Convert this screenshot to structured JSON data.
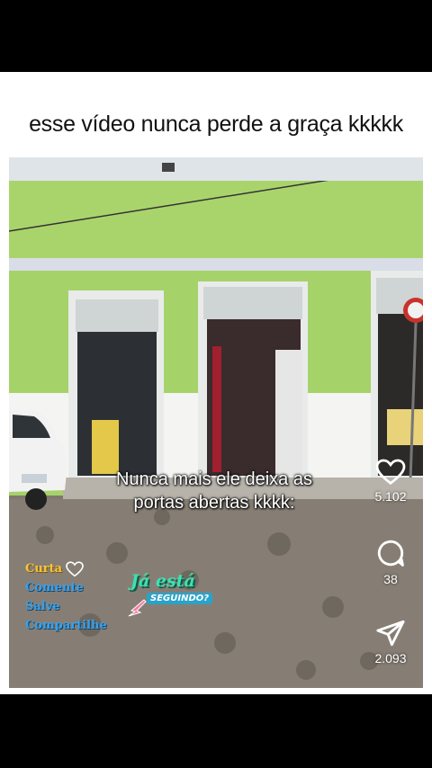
{
  "post": {
    "caption": "esse vídeo nunca perde a graça kkkkk"
  },
  "video": {
    "subtitle_line1": "Nunca mais ele deixa as",
    "subtitle_line2": "portas abertas kkkk:"
  },
  "actions": {
    "likes": "5.102",
    "comments": "38",
    "shares": "2.093"
  },
  "overlay": {
    "curta": "Curta",
    "comente": "Comente",
    "salve": "Salve",
    "compartilhe": "Compartilhe",
    "follow_main": "Já está",
    "follow_sub": "SEGUINDO?"
  },
  "colors": {
    "wall_green": "#a6d26a",
    "curta_yellow": "#f5c542",
    "overlay_blue": "#3aa0e8",
    "follow_teal": "#3fe0b0"
  },
  "icons": [
    "heart-icon",
    "comment-icon",
    "share-icon"
  ]
}
